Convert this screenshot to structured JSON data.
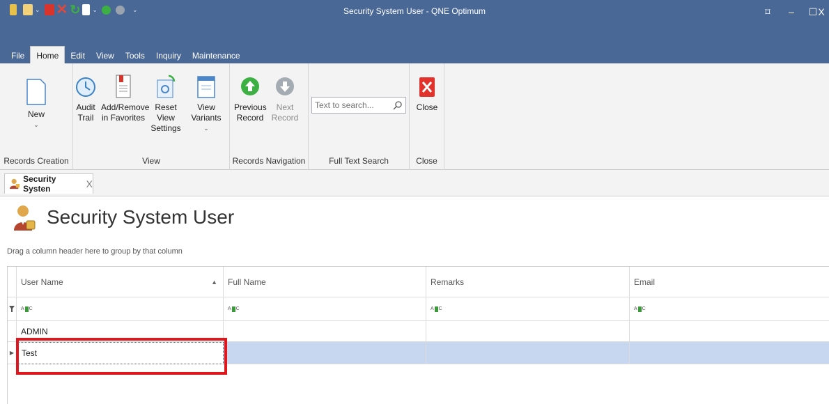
{
  "window": {
    "title": "Security System User - QNE Optimum",
    "controls": {
      "restore": "⌑",
      "minimize": "–",
      "maximize": "☐",
      "close": "X"
    }
  },
  "menu": {
    "tabs": [
      "File",
      "Home",
      "Edit",
      "View",
      "Tools",
      "Inquiry",
      "Maintenance"
    ],
    "active": "Home"
  },
  "ribbon": {
    "groups": {
      "records_creation": "Records Creation",
      "view": "View",
      "records_navigation": "Records Navigation",
      "full_text_search": "Full Text Search",
      "close": "Close"
    },
    "new": "New",
    "audit_trail": [
      "Audit",
      "Trail"
    ],
    "add_remove_favorites": [
      "Add/Remove",
      "in Favorites"
    ],
    "reset_view_settings": [
      "Reset View",
      "Settings"
    ],
    "view_variants": "View Variants",
    "previous_record": [
      "Previous",
      "Record"
    ],
    "next_record": "Next Record",
    "search_placeholder": "Text to search...",
    "close": "Close"
  },
  "document_tab": {
    "label": "Security Systen",
    "close": "X"
  },
  "page": {
    "title": "Security System User",
    "group_hint": "Drag a column header here to group by that column"
  },
  "grid": {
    "columns": [
      "User Name",
      "Full Name",
      "Remarks",
      "Email"
    ],
    "sorted_column": "User Name",
    "sort_direction": "ascending",
    "filter_symbol": "ABC",
    "rows": [
      {
        "user_name": "ADMIN",
        "full_name": "",
        "remarks": "",
        "email": ""
      },
      {
        "user_name": "Test",
        "full_name": "",
        "remarks": "",
        "email": ""
      }
    ],
    "selected_row": 1
  },
  "colors": {
    "titlebar": "#4a6896",
    "ribbon": "#f3f3f3",
    "selection": "#c7d7f0",
    "highlight": "#e0161d"
  }
}
